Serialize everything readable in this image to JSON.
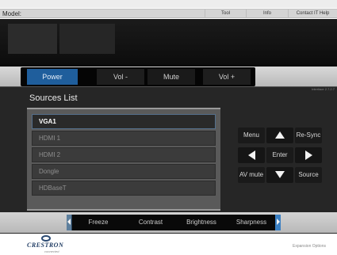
{
  "topbar": {
    "model_label": "Model:",
    "links": {
      "tool": "Tool",
      "info": "Info",
      "contact": "Contact IT Help"
    }
  },
  "controls": {
    "power": "Power",
    "vol_down": "Vol -",
    "mute": "Mute",
    "vol_up": "Vol +",
    "version": "Interface 2.7.2.7"
  },
  "sources": {
    "title": "Sources List",
    "items": [
      {
        "label": "VGA1",
        "active": true
      },
      {
        "label": "HDMI 1",
        "active": false
      },
      {
        "label": "HDMI 2",
        "active": false
      },
      {
        "label": "Dongle",
        "active": false
      },
      {
        "label": "HDBaseT",
        "active": false
      }
    ]
  },
  "remote": {
    "menu": "Menu",
    "resync": "Re-Sync",
    "enter": "Enter",
    "av_mute": "AV mute",
    "source": "Source",
    "icons": {
      "up": "arrow-up-icon",
      "down": "arrow-down-icon",
      "left": "arrow-left-icon",
      "right": "arrow-right-icon"
    }
  },
  "bottom": {
    "freeze": "Freeze",
    "contrast": "Contrast",
    "brightness": "Brightness",
    "sharpness": "Sharpness"
  },
  "footer": {
    "logo_text": "CRESTRON",
    "logo_sub": "connected",
    "expansion": "Expansion Options"
  },
  "colors": {
    "accent": "#1f5e9c",
    "panel_bg": "#262626",
    "header_bg": "#111111",
    "logo_blue": "#233f66"
  }
}
